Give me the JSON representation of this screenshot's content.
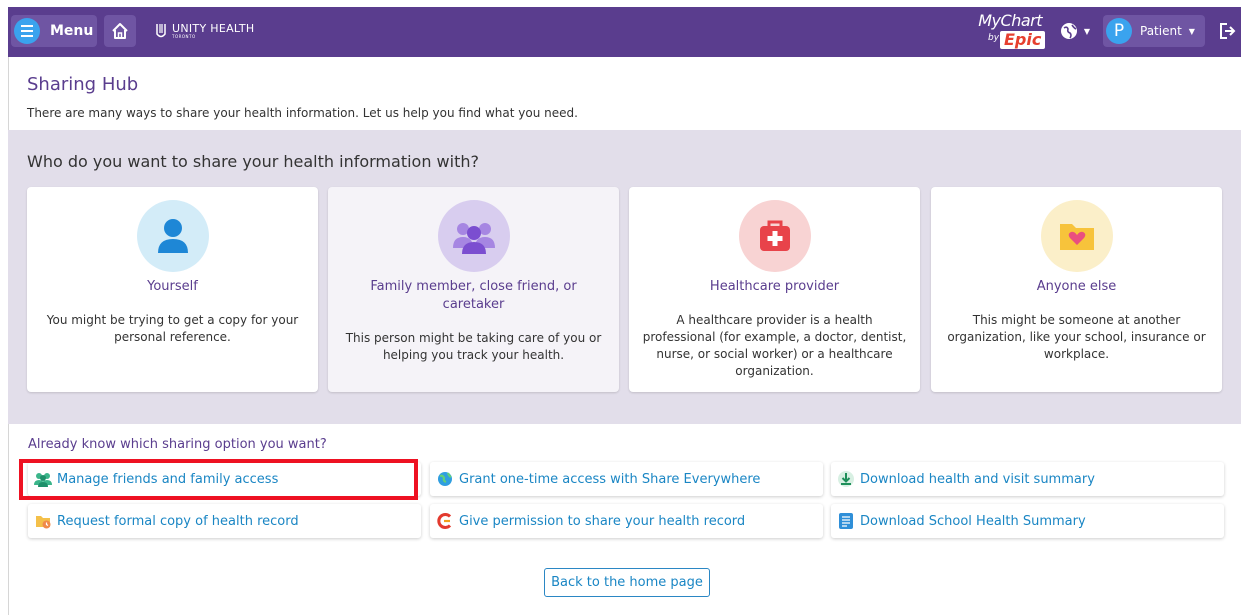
{
  "header": {
    "menu_label": "Menu",
    "logo_text": "UNITY HEALTH",
    "logo_sub": "TORONTO",
    "mychart_text": "MyChart",
    "mychart_by": "by",
    "mychart_epic": "Epic",
    "avatar_letter": "P",
    "patient_label": "Patient"
  },
  "hub": {
    "title": "Sharing Hub",
    "subtitle": "There are many ways to share your health information. Let us help you find what you need."
  },
  "who": {
    "question": "Who do you want to share your health information with?",
    "cards": [
      {
        "title": "Yourself",
        "desc": "You might be trying to get a copy for your personal reference.",
        "icon": "person-icon"
      },
      {
        "title": "Family member, close friend, or caretaker",
        "desc": "This person might be taking care of you or helping you track your health.",
        "icon": "group-icon"
      },
      {
        "title": "Healthcare provider",
        "desc": "A healthcare provider is a health professional (for example, a doctor, dentist, nurse, or social worker) or a healthcare organization.",
        "icon": "medical-bag-icon"
      },
      {
        "title": "Anyone else",
        "desc": "This might be someone at another organization, like your school, insurance or workplace.",
        "icon": "folder-heart-icon"
      }
    ]
  },
  "options": {
    "question": "Already know which sharing option you want?",
    "items": [
      {
        "label": "Manage friends and family access",
        "icon": "friends-icon"
      },
      {
        "label": "Grant one-time access with Share Everywhere",
        "icon": "globe-icon"
      },
      {
        "label": "Download health and visit summary",
        "icon": "download-icon"
      },
      {
        "label": "Request formal copy of health record",
        "icon": "record-request-icon"
      },
      {
        "label": "Give permission to share your health record",
        "icon": "care-everywhere-icon"
      },
      {
        "label": "Download School Health Summary",
        "icon": "document-icon"
      }
    ],
    "back_label": "Back to the home page"
  },
  "colors": {
    "brand": "#5a3d8e",
    "accent": "#3aa3ee",
    "link": "#1a86c4",
    "highlight": "#ee1122"
  }
}
